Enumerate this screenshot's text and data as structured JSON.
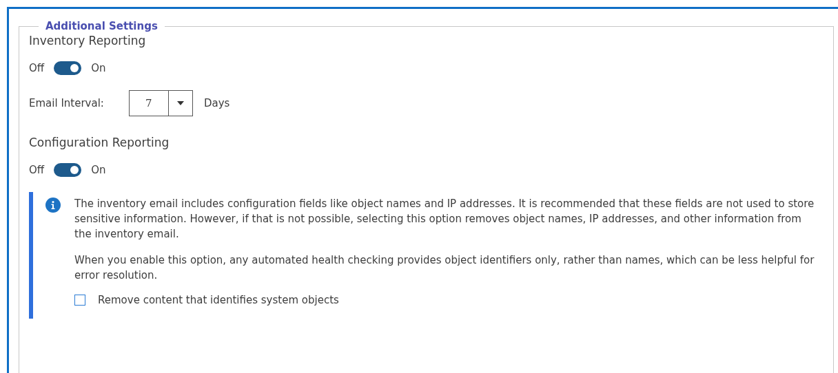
{
  "fieldset": {
    "legend": "Additional Settings"
  },
  "sections": [
    {
      "title": "Inventory Reporting",
      "toggle": {
        "off_label": "Off",
        "on_label": "On",
        "on": true
      },
      "interval": {
        "label": "Email Interval:",
        "value": "7",
        "unit": "Days"
      }
    },
    {
      "title": "Configuration Reporting",
      "toggle": {
        "off_label": "Off",
        "on_label": "On",
        "on": true
      }
    }
  ],
  "notice": {
    "paragraphs": [
      "The inventory email includes configuration fields like object names and IP addresses. It is recommended that these fields are not used to store sensitive information. However, if that is not possible, selecting this option removes object names, IP addresses, and other information from the inventory email.",
      "When you enable this option, any automated health checking provides object identifiers only, rather than names, which can be less helpful for error resolution."
    ],
    "checkbox": {
      "label": "Remove content that identifies system objects",
      "checked": false
    }
  }
}
